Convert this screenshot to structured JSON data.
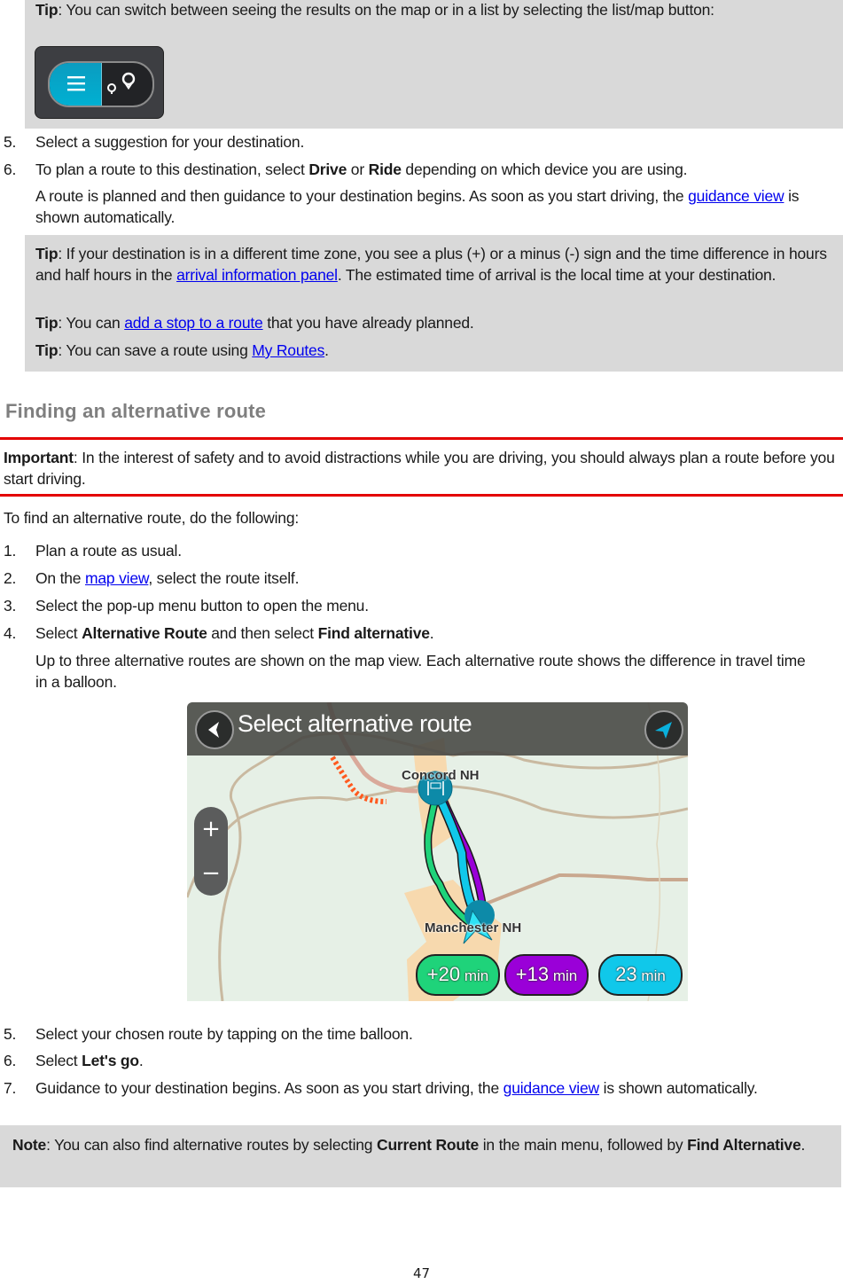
{
  "top_tip": {
    "label": "Tip",
    "text": ": You can switch between seeing the results on the map or in a list by selecting the list/map button:",
    "toggle": {
      "left_icon": "list-icon",
      "right_icon": "map-pins-icon",
      "active": "list"
    }
  },
  "steps_a": [
    {
      "num": "5.",
      "text": "Select a suggestion for your destination."
    },
    {
      "num": "6.",
      "pre": "To plan a route to this destination, select ",
      "b1": "Drive",
      "mid": " or ",
      "b2": "Ride",
      "post": " depending on which device you are using.",
      "followup_pre": "A route is planned and then guidance to your destination begins. As soon as you start driving, the ",
      "followup_link": "guidance view",
      "followup_post": " is shown automatically."
    }
  ],
  "tips_box": {
    "tip1": {
      "label": "Tip",
      "pre": ": If your destination is in a different time zone, you see a plus (+) or a minus (-) sign and the time difference in hours and half hours in the ",
      "link": "arrival information panel",
      "post": ". The estimated time of arrival is the local time at your destination."
    },
    "tip2": {
      "label": "Tip",
      "pre": ": You can ",
      "link": "add a stop to a route",
      "post": " that you have already planned."
    },
    "tip3": {
      "label": "Tip",
      "pre": ": You can save a route using ",
      "link": "My Routes",
      "post": "."
    }
  },
  "section": {
    "heading": "Finding an alternative route",
    "important_label": "Important",
    "important_text": ": In the interest of safety and to avoid distractions while you are driving, you should always plan a route before you start driving.",
    "intro": "To find an alternative route, do the following:"
  },
  "steps_b": [
    {
      "num": "1.",
      "text": "Plan a route as usual."
    },
    {
      "num": "2.",
      "pre": "On the ",
      "link": "map view",
      "post": ", select the route itself."
    },
    {
      "num": "3.",
      "text": "Select the pop-up menu button to open the menu."
    },
    {
      "num": "4.",
      "pre": "Select ",
      "b1": "Alternative Route",
      "mid": " and then select ",
      "b2": "Find alternative",
      "post": ".",
      "followup": "Up to three alternative routes are shown on the map view. Each alternative route shows the difference in travel time in a balloon."
    }
  ],
  "map_screen": {
    "title": "Select alternative route",
    "back_icon": "back-arrow-icon",
    "locate_icon": "location-arrow-icon",
    "zoom_in": "+",
    "zoom_out": "−",
    "place_top": "Concord NH",
    "place_bottom": "Manchester NH",
    "balloons": [
      {
        "value": "+20",
        "unit": "min",
        "color": "#1fd37a"
      },
      {
        "value": "+13",
        "unit": "min",
        "color": "#9a00d8"
      },
      {
        "value": "23",
        "unit": "min",
        "color": "#10c8ea"
      }
    ]
  },
  "steps_c": [
    {
      "num": "5.",
      "text": "Select your chosen route by tapping on the time balloon."
    },
    {
      "num": "6.",
      "pre": "Select ",
      "b1": "Let's go",
      "post": "."
    },
    {
      "num": "7.",
      "pre": "Guidance to your destination begins. As soon as you start driving, the ",
      "link": "guidance view",
      "post": " is shown automatically."
    }
  ],
  "note": {
    "label": "Note",
    "pre": ": You can also find alternative routes by selecting ",
    "b1": "Current Route",
    "mid": " in the main menu, followed by ",
    "b2": "Find Alternative",
    "post": "."
  },
  "page_number": "47",
  "colors": {
    "link": "#0000ee",
    "important_rule": "#e30000",
    "tip_background": "#d9d9d9",
    "heading": "#7f7f7f"
  }
}
